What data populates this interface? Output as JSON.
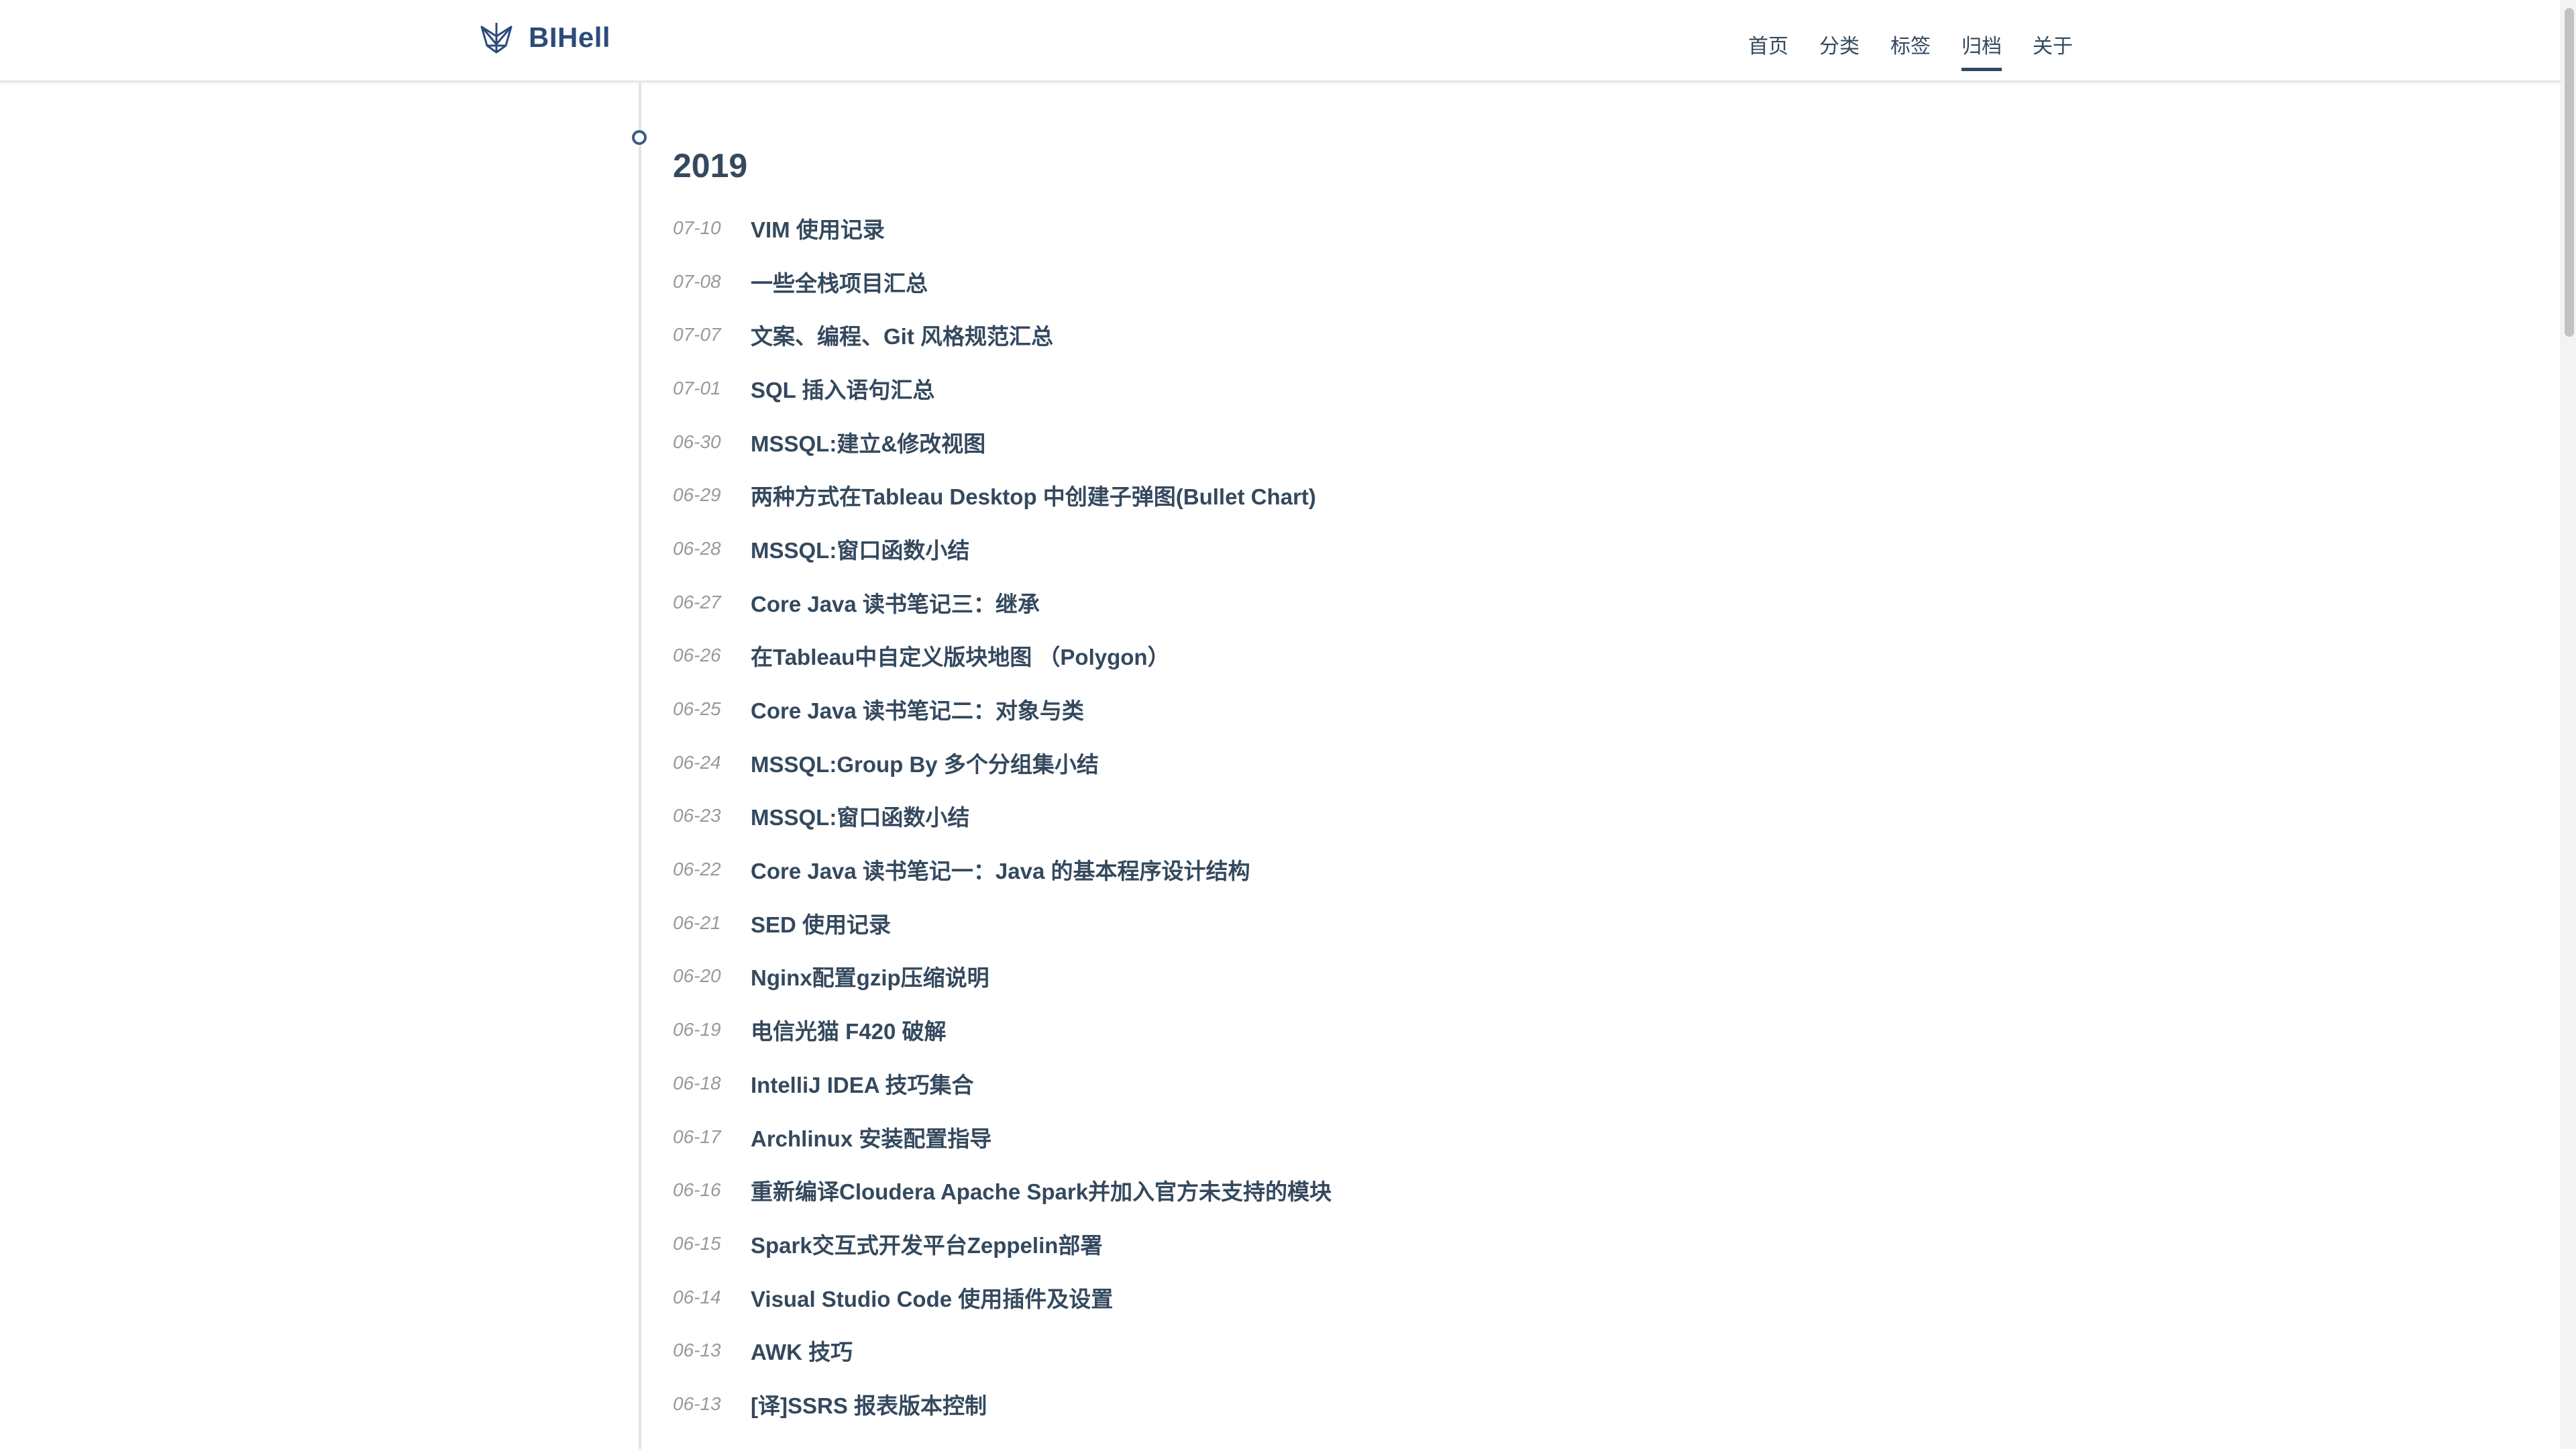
{
  "header": {
    "brand": "BIHell",
    "nav": [
      {
        "label": "首页",
        "active": false
      },
      {
        "label": "分类",
        "active": false
      },
      {
        "label": "标签",
        "active": false
      },
      {
        "label": "归档",
        "active": true
      },
      {
        "label": "关于",
        "active": false
      }
    ]
  },
  "icons": {
    "brand_logo": "ship-logo-icon",
    "timeline_marker": "circle-marker-icon"
  },
  "colors": {
    "brand": "#2c4b7a",
    "text": "#34495e",
    "date": "#999999",
    "timeline": "#e4e4e4"
  },
  "archive": {
    "year": "2019",
    "posts": [
      {
        "date": "07-10",
        "title": "VIM 使用记录"
      },
      {
        "date": "07-08",
        "title": "一些全栈项目汇总"
      },
      {
        "date": "07-07",
        "title": "文案、编程、Git 风格规范汇总"
      },
      {
        "date": "07-01",
        "title": "SQL 插入语句汇总"
      },
      {
        "date": "06-30",
        "title": "MSSQL:建立&修改视图"
      },
      {
        "date": "06-29",
        "title": "两种方式在Tableau Desktop 中创建子弹图(Bullet Chart)"
      },
      {
        "date": "06-28",
        "title": "MSSQL:窗口函数小结"
      },
      {
        "date": "06-27",
        "title": "Core Java 读书笔记三：继承"
      },
      {
        "date": "06-26",
        "title": "在Tableau中自定义版块地图 （Polygon）"
      },
      {
        "date": "06-25",
        "title": "Core Java 读书笔记二：对象与类"
      },
      {
        "date": "06-24",
        "title": "MSSQL:Group By 多个分组集小结"
      },
      {
        "date": "06-23",
        "title": "MSSQL:窗口函数小结"
      },
      {
        "date": "06-22",
        "title": "Core Java 读书笔记一：Java 的基本程序设计结构"
      },
      {
        "date": "06-21",
        "title": "SED 使用记录"
      },
      {
        "date": "06-20",
        "title": "Nginx配置gzip压缩说明"
      },
      {
        "date": "06-19",
        "title": "电信光猫 F420 破解"
      },
      {
        "date": "06-18",
        "title": "IntelliJ IDEA 技巧集合"
      },
      {
        "date": "06-17",
        "title": "Archlinux 安装配置指导"
      },
      {
        "date": "06-16",
        "title": "重新编译Cloudera Apache Spark并加入官方未支持的模块"
      },
      {
        "date": "06-15",
        "title": "Spark交互式开发平台Zeppelin部署"
      },
      {
        "date": "06-14",
        "title": "Visual Studio Code 使用插件及设置"
      },
      {
        "date": "06-13",
        "title": "AWK 技巧"
      },
      {
        "date": "06-13",
        "title": "[译]SSRS 报表版本控制"
      }
    ]
  }
}
